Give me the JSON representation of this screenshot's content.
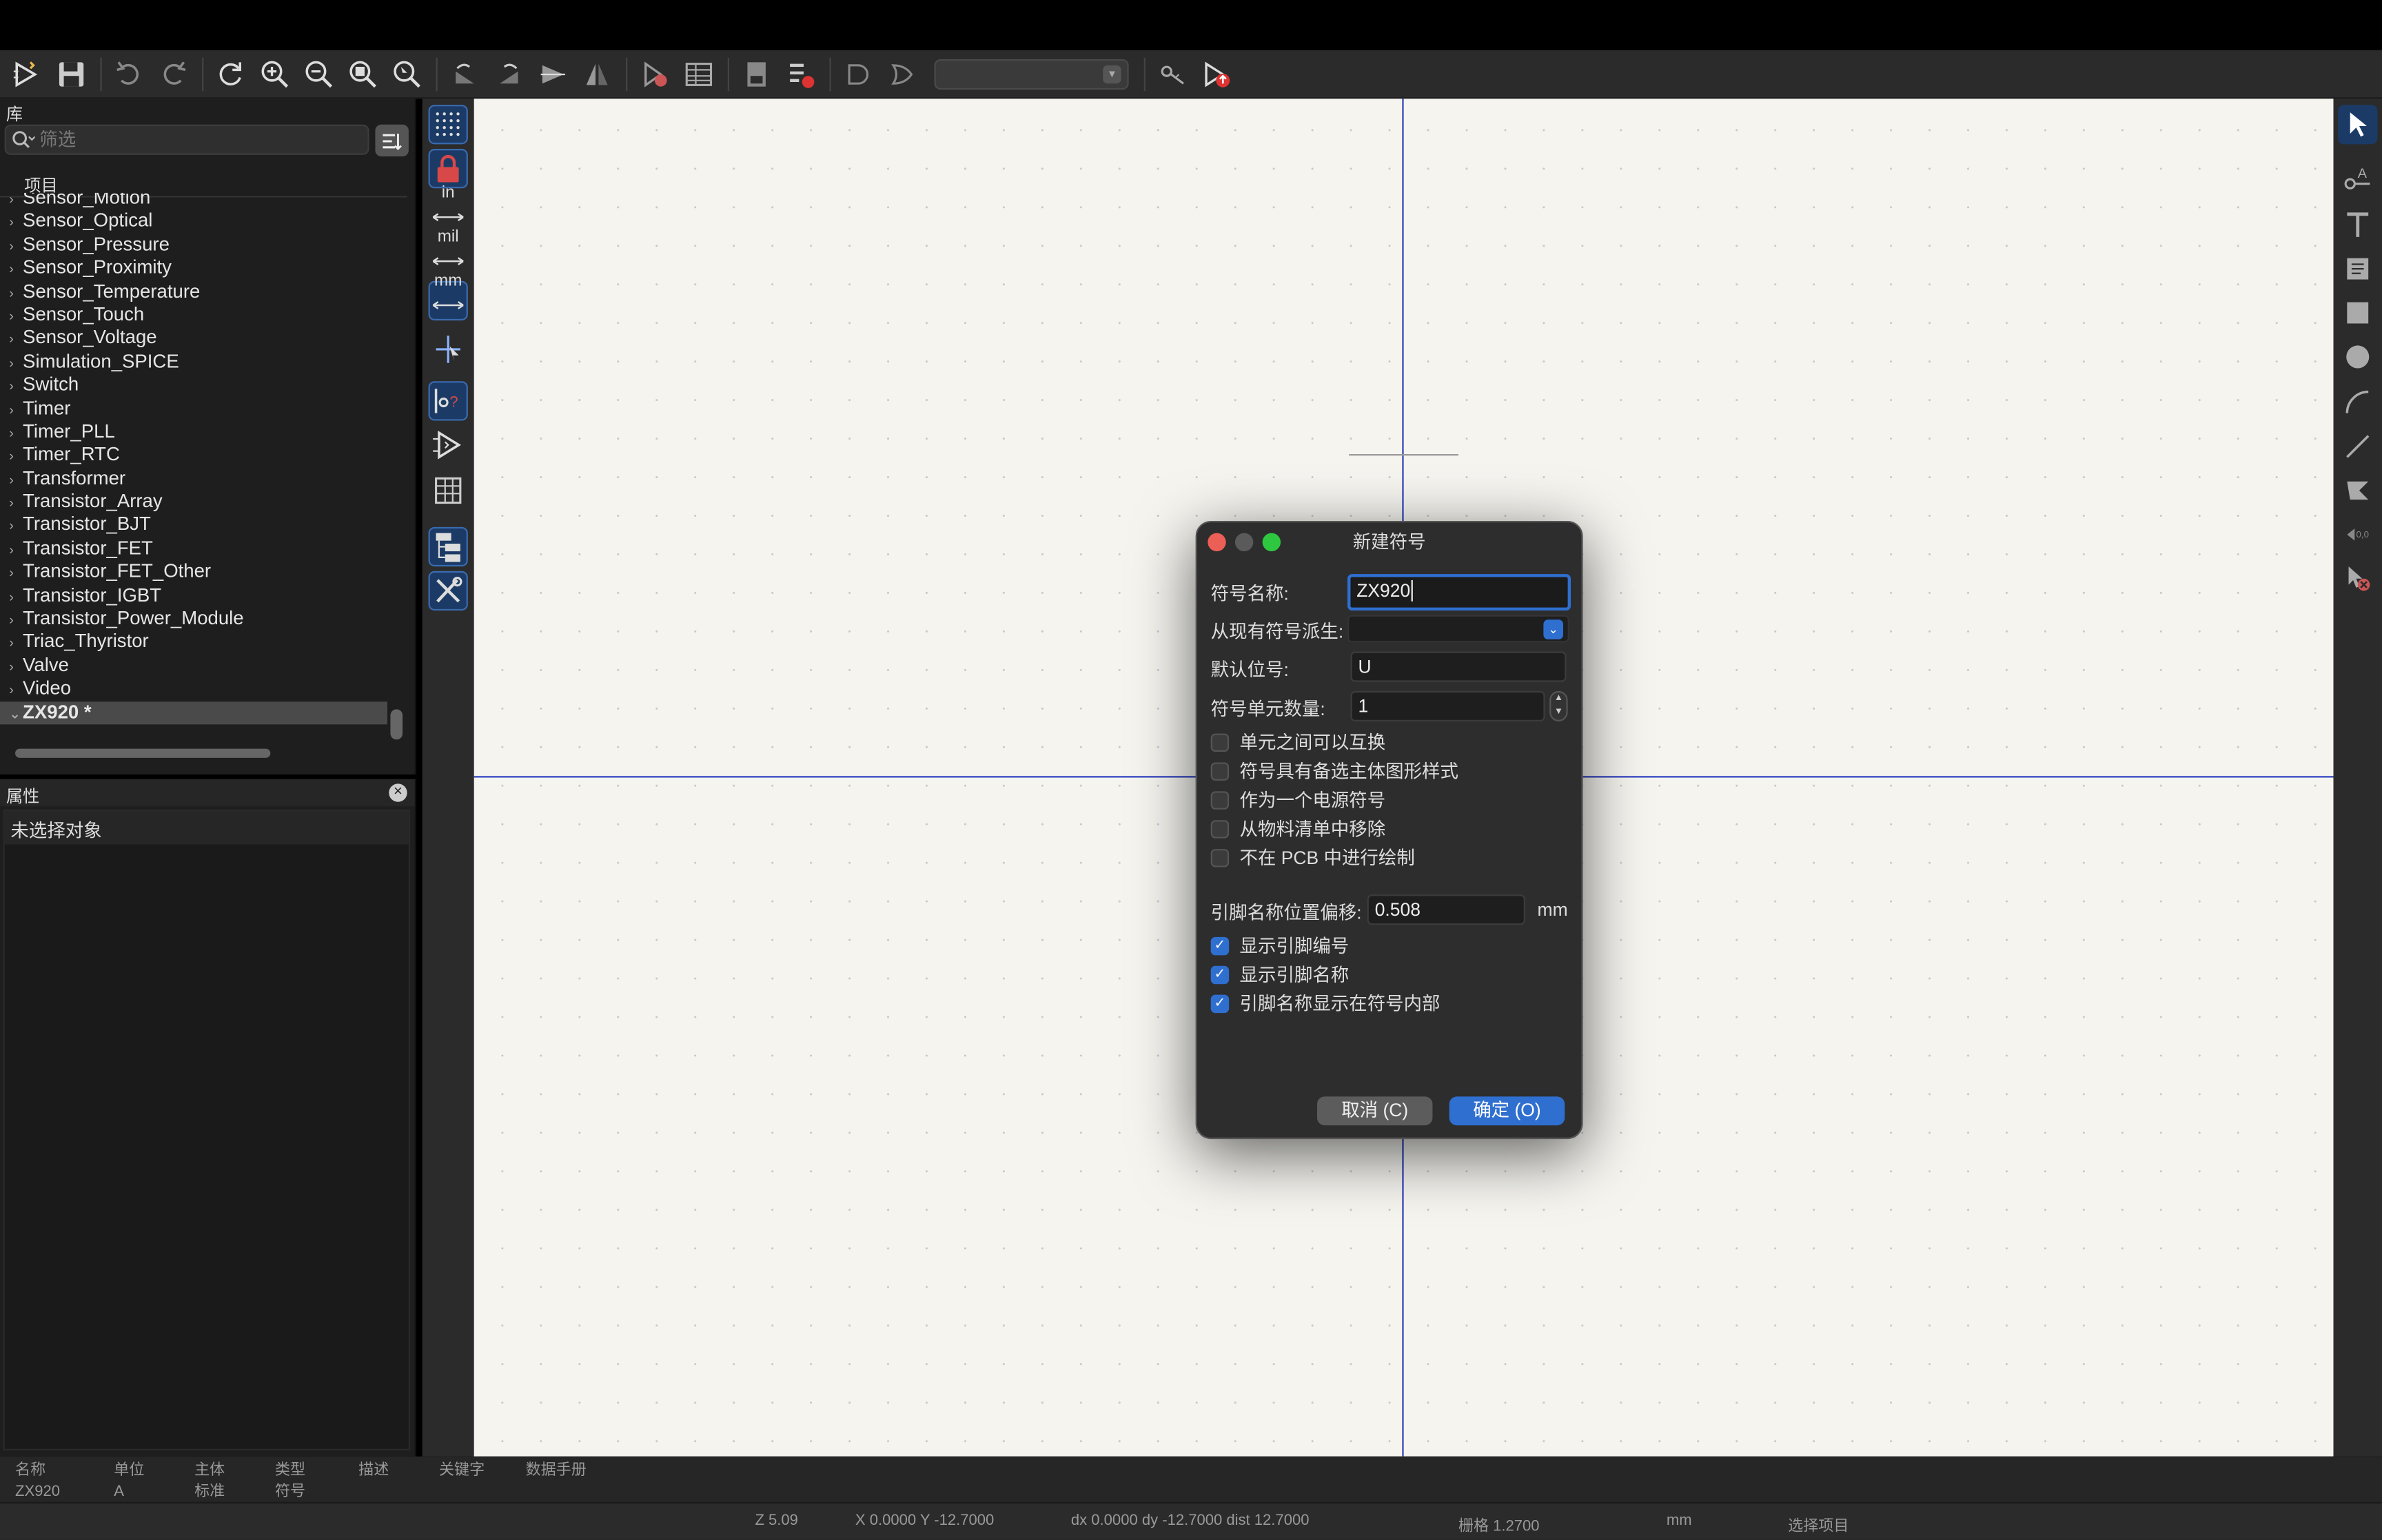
{
  "toolbar": {
    "icons": [
      "new-symbol-icon",
      "save-icon",
      "undo-icon",
      "redo-icon",
      "refresh-icon",
      "zoom-in-icon",
      "zoom-out-icon",
      "zoom-fit-icon",
      "zoom-selection-icon",
      "rotate-ccw-icon",
      "rotate-cw-icon",
      "mirror-v-icon",
      "mirror-h-icon",
      "symbol-checker-icon",
      "pin-table-icon",
      "datasheet-icon",
      "symbol-props-icon",
      "de-morgan-standard-icon",
      "de-morgan-alternate-icon",
      "unit-select",
      "show-pins-icon",
      "update-symbol-icon"
    ]
  },
  "library": {
    "header": "库",
    "filter_placeholder": "筛选",
    "column_header": "项目",
    "items": [
      {
        "label": "Sensor_Motion",
        "expanded": false
      },
      {
        "label": "Sensor_Optical",
        "expanded": false
      },
      {
        "label": "Sensor_Pressure",
        "expanded": false
      },
      {
        "label": "Sensor_Proximity",
        "expanded": false
      },
      {
        "label": "Sensor_Temperature",
        "expanded": false
      },
      {
        "label": "Sensor_Touch",
        "expanded": false
      },
      {
        "label": "Sensor_Voltage",
        "expanded": false
      },
      {
        "label": "Simulation_SPICE",
        "expanded": false
      },
      {
        "label": "Switch",
        "expanded": false
      },
      {
        "label": "Timer",
        "expanded": false
      },
      {
        "label": "Timer_PLL",
        "expanded": false
      },
      {
        "label": "Timer_RTC",
        "expanded": false
      },
      {
        "label": "Transformer",
        "expanded": false
      },
      {
        "label": "Transistor_Array",
        "expanded": false
      },
      {
        "label": "Transistor_BJT",
        "expanded": false
      },
      {
        "label": "Transistor_FET",
        "expanded": false
      },
      {
        "label": "Transistor_FET_Other",
        "expanded": false
      },
      {
        "label": "Transistor_IGBT",
        "expanded": false
      },
      {
        "label": "Transistor_Power_Module",
        "expanded": false
      },
      {
        "label": "Triac_Thyristor",
        "expanded": false
      },
      {
        "label": "Valve",
        "expanded": false
      },
      {
        "label": "Video",
        "expanded": false
      },
      {
        "label": "ZX920 *",
        "expanded": true,
        "selected": true
      }
    ]
  },
  "properties": {
    "header": "属性",
    "none_selected": "未选择对象"
  },
  "left_tools": {
    "unit_in": "in",
    "unit_mil": "mil",
    "unit_mm": "mm"
  },
  "dialog": {
    "title": "新建符号",
    "name_label": "符号名称:",
    "name_value": "ZX920",
    "derive_label": "从现有符号派生:",
    "derive_value": "",
    "ref_label": "默认位号:",
    "ref_value": "U",
    "units_label": "符号单元数量:",
    "units_value": "1",
    "checkboxes": [
      {
        "label": "单元之间可以互换",
        "checked": false
      },
      {
        "label": "符号具有备选主体图形样式",
        "checked": false
      },
      {
        "label": "作为一个电源符号",
        "checked": false
      },
      {
        "label": "从物料清单中移除",
        "checked": false
      },
      {
        "label": "不在 PCB 中进行绘制",
        "checked": false
      }
    ],
    "offset_label": "引脚名称位置偏移:",
    "offset_value": "0.508",
    "offset_unit": "mm",
    "pin_checkboxes": [
      {
        "label": "显示引脚编号",
        "checked": true
      },
      {
        "label": "显示引脚名称",
        "checked": true
      },
      {
        "label": "引脚名称显示在符号内部",
        "checked": true
      }
    ],
    "cancel_label": "取消 (C)",
    "ok_label": "确定 (O)"
  },
  "info": {
    "columns": [
      {
        "header": "名称",
        "value": "ZX920"
      },
      {
        "header": "单位",
        "value": "A"
      },
      {
        "header": "主体",
        "value": "标准"
      },
      {
        "header": "类型",
        "value": "符号"
      },
      {
        "header": "描述",
        "value": ""
      },
      {
        "header": "关键字",
        "value": ""
      },
      {
        "header": "数据手册",
        "value": ""
      }
    ]
  },
  "status": {
    "zoom": "Z 5.09",
    "coords": "X 0.0000  Y -12.7000",
    "delta": "dx 0.0000  dy -12.7000  dist 12.7000",
    "grid": "栅格 1.2700",
    "units": "mm",
    "mode": "选择项目"
  },
  "colors": {
    "accent": "#2f6fd0",
    "axis": "#2a3cbf",
    "canvas": "#f5f4ef"
  }
}
